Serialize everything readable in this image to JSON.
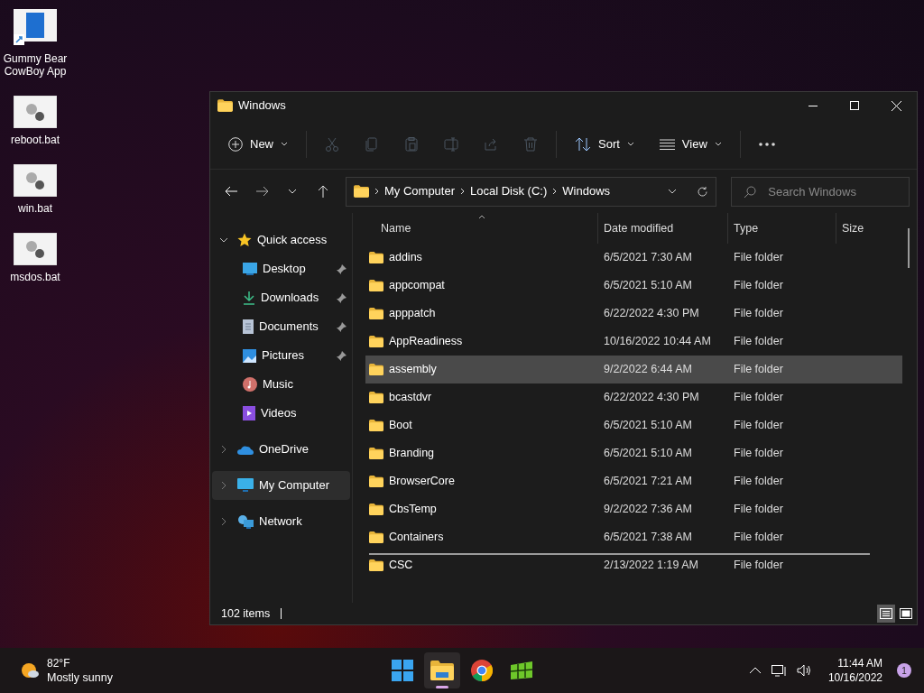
{
  "desktop_icons": [
    {
      "label": "Gummy Bear CowBoy App",
      "kind": "shortcut"
    },
    {
      "label": "reboot.bat",
      "kind": "script"
    },
    {
      "label": "win.bat",
      "kind": "script"
    },
    {
      "label": "msdos.bat",
      "kind": "script"
    }
  ],
  "window": {
    "title": "Windows"
  },
  "toolbar": [
    {
      "kind": "new",
      "label": "New",
      "disabled": false
    },
    {
      "kind": "cut",
      "disabled": true
    },
    {
      "kind": "copy",
      "disabled": true
    },
    {
      "kind": "paste",
      "disabled": true
    },
    {
      "kind": "rename",
      "disabled": true
    },
    {
      "kind": "share",
      "disabled": true
    },
    {
      "kind": "delete",
      "disabled": true
    },
    {
      "kind": "sort",
      "label": "Sort",
      "disabled": false
    },
    {
      "kind": "view",
      "label": "View",
      "disabled": false
    },
    {
      "kind": "more",
      "disabled": false
    }
  ],
  "address": {
    "crumbs": [
      "My Computer",
      "Local Disk (C:)",
      "Windows"
    ]
  },
  "search": {
    "placeholder": "Search Windows"
  },
  "nav": [
    {
      "label": "Quick access",
      "kind": "quick",
      "expanded": true,
      "selected": false,
      "children": [
        {
          "label": "Desktop",
          "kind": "desktop",
          "pinned": true,
          "selected": false
        },
        {
          "label": "Downloads",
          "kind": "downloads",
          "pinned": true,
          "selected": false
        },
        {
          "label": "Documents",
          "kind": "documents",
          "pinned": true,
          "selected": false
        },
        {
          "label": "Pictures",
          "kind": "pictures",
          "pinned": true,
          "selected": false
        },
        {
          "label": "Music",
          "kind": "music",
          "pinned": false,
          "selected": false
        },
        {
          "label": "Videos",
          "kind": "videos",
          "pinned": false,
          "selected": false
        }
      ]
    },
    {
      "label": "OneDrive",
      "kind": "cloud",
      "expanded": false,
      "selected": false
    },
    {
      "label": "My Computer",
      "kind": "computer",
      "expanded": false,
      "selected": true
    },
    {
      "label": "Network",
      "kind": "network",
      "expanded": false,
      "selected": false
    }
  ],
  "columns": [
    {
      "label": "Name",
      "sorted": true
    },
    {
      "label": "Date modified",
      "sorted": false
    },
    {
      "label": "Type",
      "sorted": false
    },
    {
      "label": "Size",
      "sorted": false
    }
  ],
  "rows": [
    {
      "name": "addins",
      "date": "6/5/2021 7:30 AM",
      "type": "File folder",
      "selected": false
    },
    {
      "name": "appcompat",
      "date": "6/5/2021 5:10 AM",
      "type": "File folder",
      "selected": false
    },
    {
      "name": "apppatch",
      "date": "6/22/2022 4:30 PM",
      "type": "File folder",
      "selected": false
    },
    {
      "name": "AppReadiness",
      "date": "10/16/2022 10:44 AM",
      "type": "File folder",
      "selected": false
    },
    {
      "name": "assembly",
      "date": "9/2/2022 6:44 AM",
      "type": "File folder",
      "selected": true
    },
    {
      "name": "bcastdvr",
      "date": "6/22/2022 4:30 PM",
      "type": "File folder",
      "selected": false
    },
    {
      "name": "Boot",
      "date": "6/5/2021 5:10 AM",
      "type": "File folder",
      "selected": false
    },
    {
      "name": "Branding",
      "date": "6/5/2021 5:10 AM",
      "type": "File folder",
      "selected": false
    },
    {
      "name": "BrowserCore",
      "date": "6/5/2021 7:21 AM",
      "type": "File folder",
      "selected": false
    },
    {
      "name": "CbsTemp",
      "date": "9/2/2022 7:36 AM",
      "type": "File folder",
      "selected": false
    },
    {
      "name": "Containers",
      "date": "6/5/2021 7:38 AM",
      "type": "File folder",
      "selected": false
    },
    {
      "name": "CSC",
      "date": "2/13/2022 1:19 AM",
      "type": "File folder",
      "selected": false
    }
  ],
  "status_bar": {
    "count": "102 items",
    "views": [
      {
        "kind": "details",
        "selected": true
      },
      {
        "kind": "tiles",
        "selected": false
      }
    ]
  },
  "taskbar": {
    "weather": {
      "temp": "82°F",
      "condition": "Mostly sunny"
    },
    "apps": [
      {
        "kind": "start",
        "active": false
      },
      {
        "kind": "explorer",
        "active": true
      },
      {
        "kind": "chrome",
        "active": false
      },
      {
        "kind": "game",
        "active": false
      }
    ],
    "time": "11:44 AM",
    "date": "10/16/2022",
    "notifications": "1"
  }
}
